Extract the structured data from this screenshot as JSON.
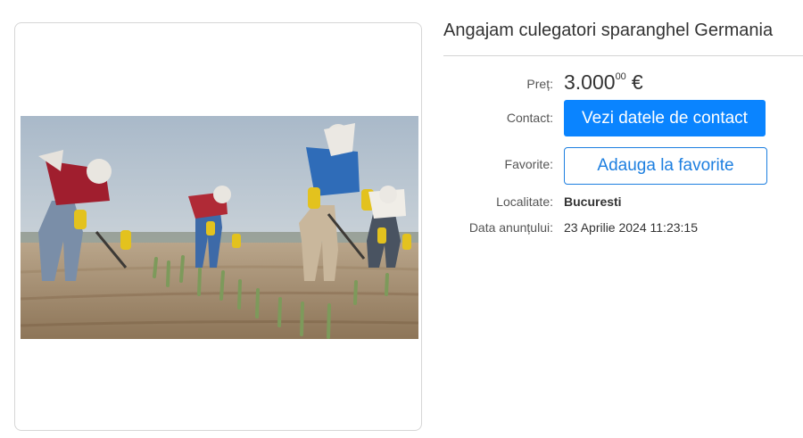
{
  "listing": {
    "title": "Angajam culegatori sparanghel Germania",
    "image_description": "Muncitori culegand sparanghel pe camp"
  },
  "details": {
    "price_label": "Preț:",
    "price_main": "3.000",
    "price_decimals": "00",
    "price_currency": "€",
    "contact_label": "Contact:",
    "contact_button": "Vezi datele de contact",
    "favorites_label": "Favorite:",
    "favorites_button": "Adauga la favorite",
    "location_label": "Localitate:",
    "location_value": "Bucuresti",
    "date_label": "Data anunțului:",
    "date_value": "23 Aprilie 2024 11:23:15"
  },
  "colors": {
    "primary": "#0a84ff",
    "outline": "#1d7fe0"
  }
}
